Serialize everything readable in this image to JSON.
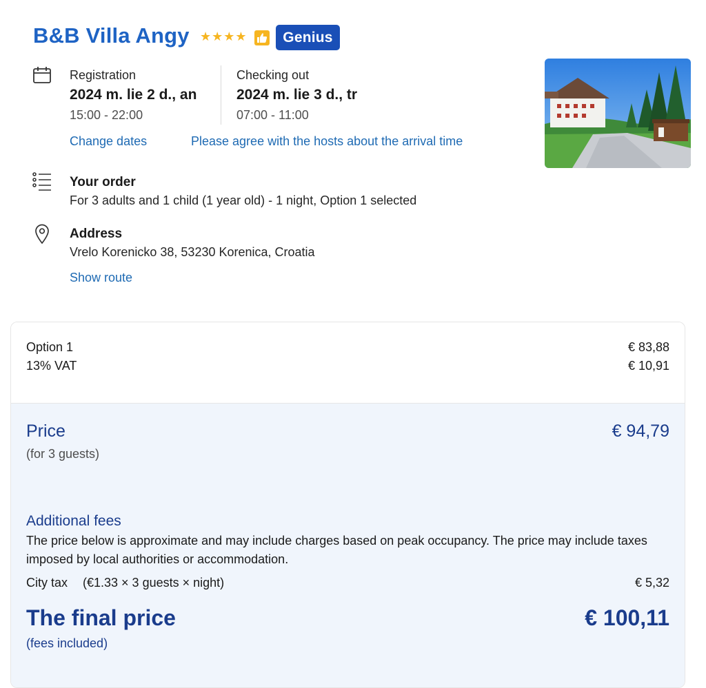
{
  "hotel": {
    "name": "B&B Villa Angy",
    "stars": "★★★★",
    "badge": "Genius"
  },
  "checkin": {
    "label": "Registration",
    "date": "2024 m. lie 2 d., an",
    "time": "15:00 - 22:00"
  },
  "checkout": {
    "label": "Checking out",
    "date": "2024 m. lie 3 d., tr",
    "time": "07:00 - 11:00"
  },
  "links": {
    "change_dates": "Change dates",
    "arrival": "Please agree with the hosts about the arrival time",
    "show_route": "Show route"
  },
  "order": {
    "title": "Your order",
    "detail": "For 3 adults and 1 child (1 year old) - 1 night, Option 1 selected"
  },
  "address": {
    "title": "Address",
    "value": "Vrelo Korenicko 38, 53230 Korenica, Croatia"
  },
  "breakdown": {
    "option_label": "Option 1",
    "option_value": "€ 83,88",
    "vat_label": "13% VAT",
    "vat_value": "€ 10,91"
  },
  "price": {
    "label": "Price",
    "value": "€ 94,79",
    "sub": "(for 3 guests)"
  },
  "fees": {
    "title": "Additional fees",
    "text": "The price below is approximate and may include charges based on peak occupancy. The price may include taxes imposed by local authorities or accommodation.",
    "city_tax_label": "City tax",
    "city_tax_detail": "(€1.33 × 3 guests × night)",
    "city_tax_value": "€ 5,32"
  },
  "final": {
    "label": "The final price",
    "value": "€ 100,11",
    "sub": "(fees included)"
  },
  "colors": {
    "brand_blue": "#1e63c4",
    "genius_blue": "#1a4fb7",
    "star_yellow": "#f6b521",
    "link_blue": "#1e6ab3",
    "price_navy": "#1a3c8c",
    "panel_bg": "#f0f5fc"
  },
  "icons": [
    "calendar-icon",
    "list-icon",
    "location-pin-icon",
    "thumbs-up-icon"
  ]
}
